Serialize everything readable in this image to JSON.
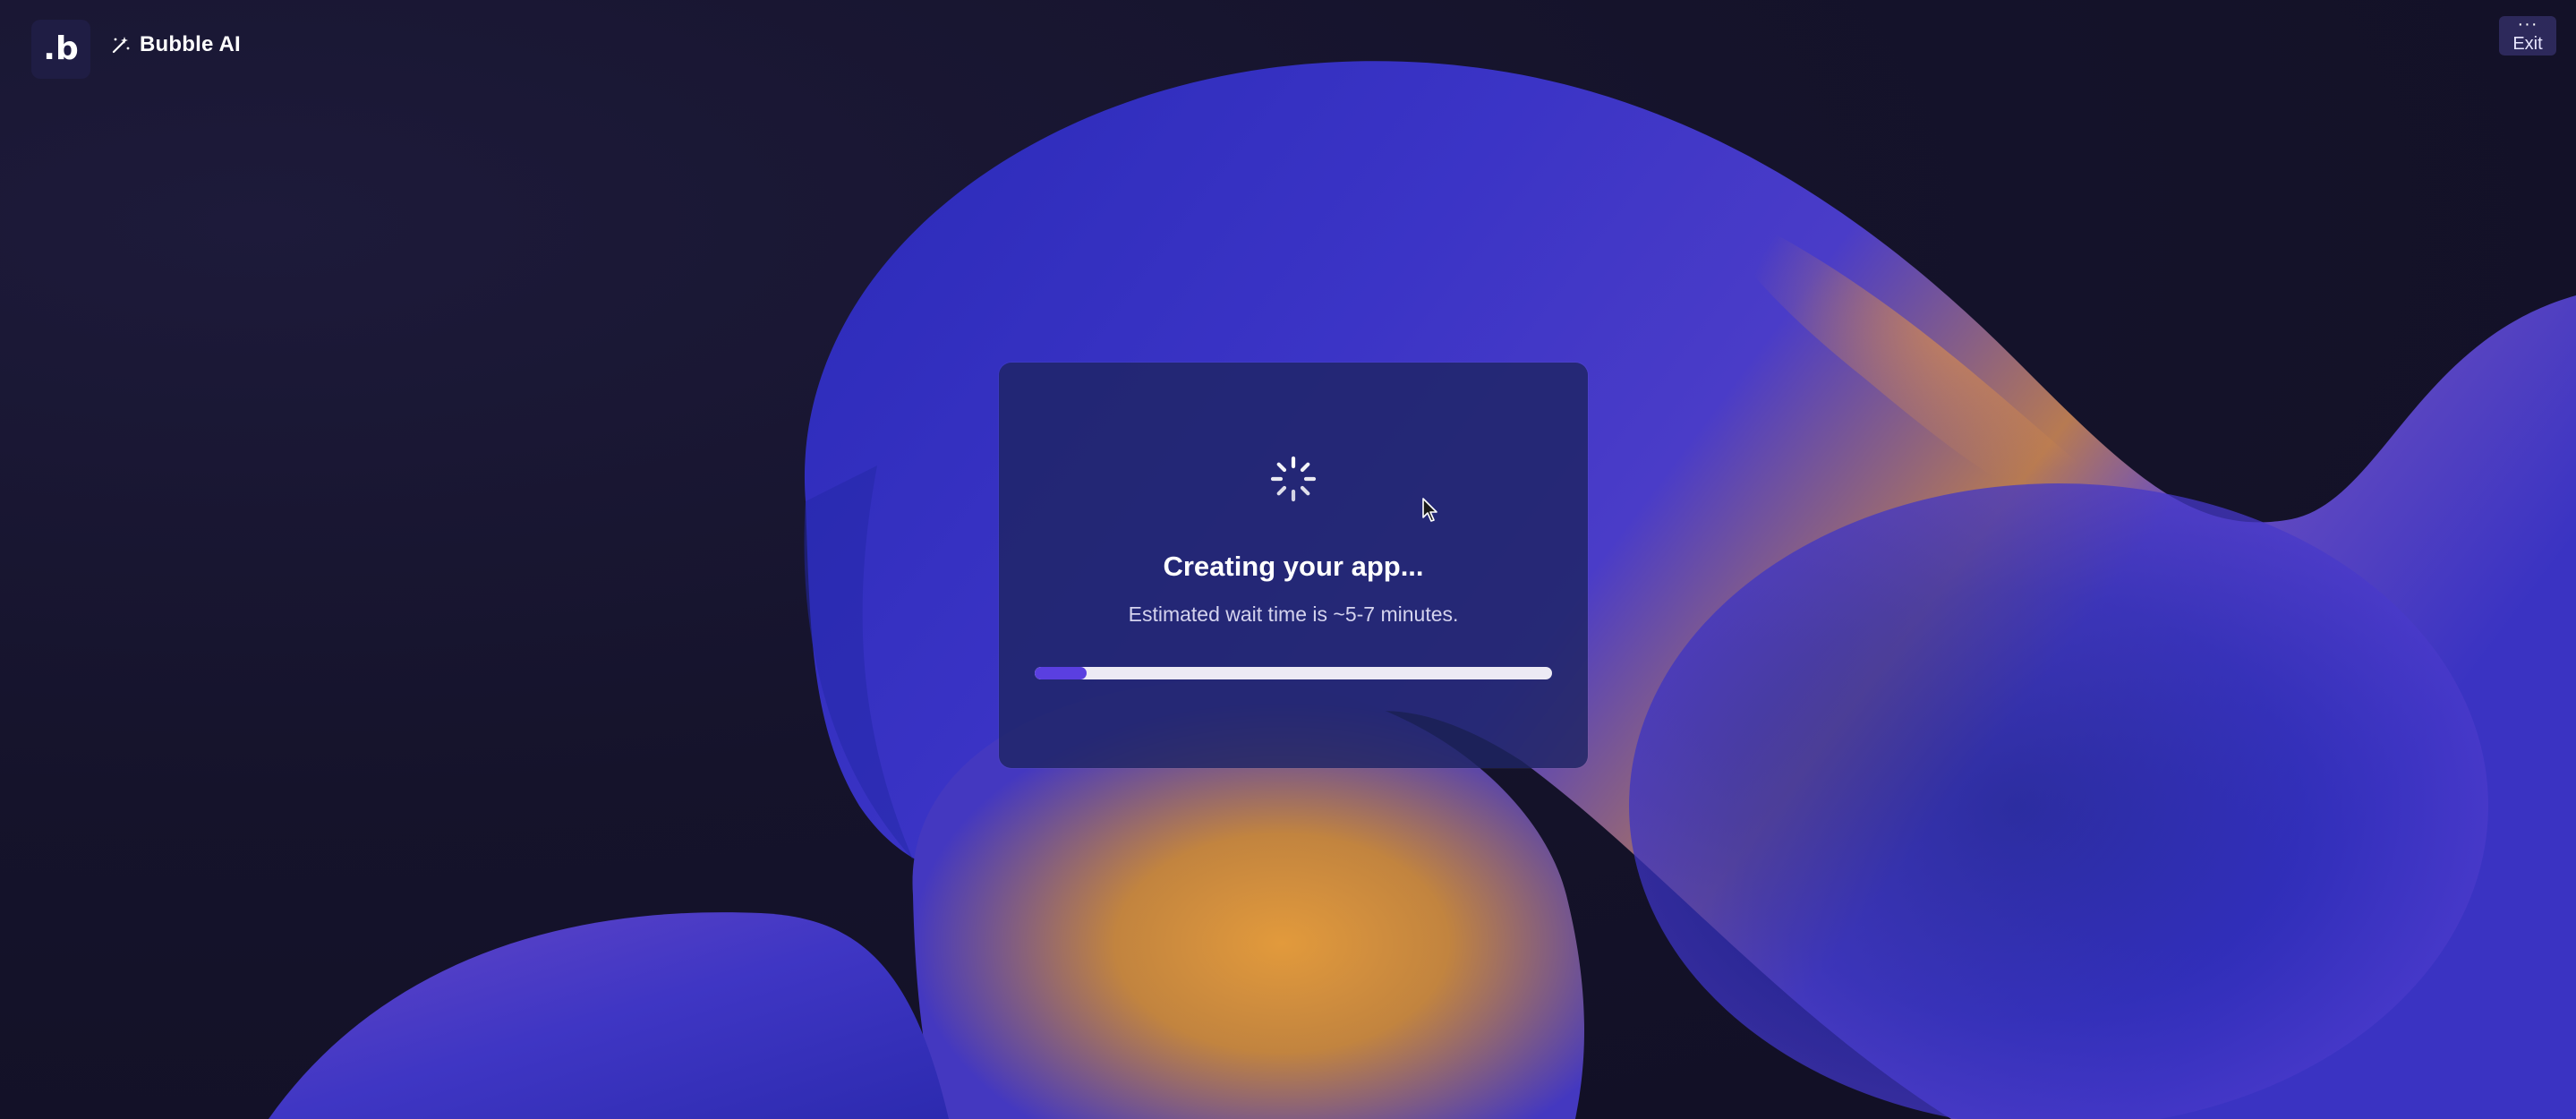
{
  "header": {
    "logo_text": ".b",
    "brand_icon": "magic-wand-icon",
    "brand_label": "Bubble AI"
  },
  "exit": {
    "menu_icon": "more-dots-icon",
    "dots_glyph": "···",
    "label": "Exit"
  },
  "card": {
    "spinner_icon": "loading-spinner-icon",
    "title": "Creating your app...",
    "subtitle": "Estimated wait time is ~5-7 minutes.",
    "progress": 0.1
  },
  "colors": {
    "accent": "#5a3fe0",
    "background": "#14122a",
    "blob_blue": "#3f34c8",
    "blob_orange": "#d48a37"
  }
}
